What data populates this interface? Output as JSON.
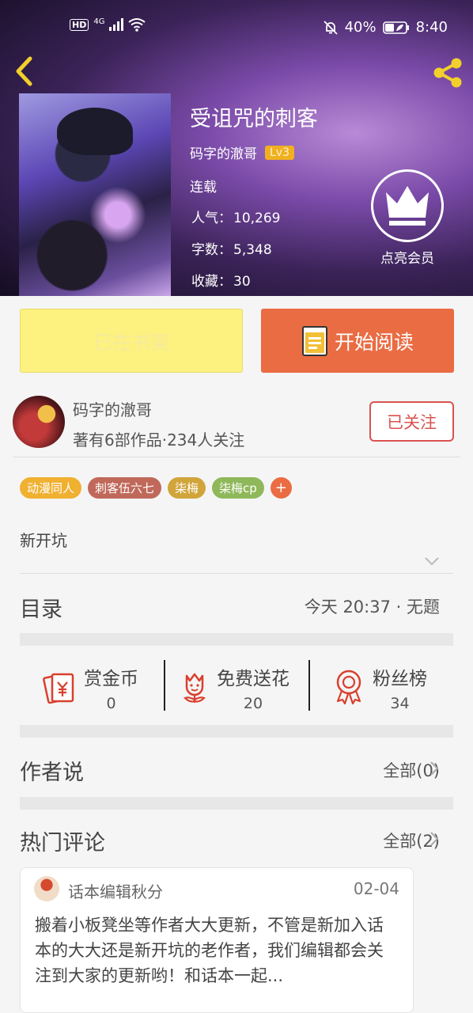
{
  "status_bar": {
    "hd": "HD",
    "network": "4G",
    "battery": "40%",
    "time": "8:40"
  },
  "book": {
    "title": "受诅咒的刺客",
    "author": "码字的澈哥",
    "level": "Lv3",
    "status": "连载",
    "popularity_label": "人气：",
    "popularity": "10,269",
    "words_label": "字数：",
    "words": "5,348",
    "favorites_label": "收藏：",
    "favorites": "30"
  },
  "vip": {
    "label": "点亮会员"
  },
  "actions": {
    "shelf_label": "已在书架",
    "read_label": "开始阅读"
  },
  "author_card": {
    "name": "码字的澈哥",
    "stats": "著有6部作品·234人关注",
    "follow_label": "已关注"
  },
  "tags": [
    {
      "label": "动漫同人",
      "color": "#f0b030"
    },
    {
      "label": "刺客伍六七",
      "color": "#c0695a"
    },
    {
      "label": "柒梅",
      "color": "#d1a53a"
    },
    {
      "label": "柒梅cp",
      "color": "#8fb85a"
    }
  ],
  "tag_add": "+",
  "description": "新开坑",
  "catalog": {
    "title": "目录",
    "latest": "今天 20:37 · 无题"
  },
  "rewards": [
    {
      "label": "赏金币",
      "value": "0",
      "icon": "red-envelope-icon"
    },
    {
      "label": "免费送花",
      "value": "20",
      "icon": "flower-icon"
    },
    {
      "label": "粉丝榜",
      "value": "34",
      "icon": "medal-icon"
    }
  ],
  "author_says": {
    "title": "作者说",
    "all": "全部(0)"
  },
  "hot_comments": {
    "title": "热门评论",
    "all": "全部(2)"
  },
  "comment": {
    "user": "话本编辑秋分",
    "date": "02-04",
    "text": "搬着小板凳坐等作者大大更新，不管是新加入话本的大大还是新开坑的老作者，我们编辑都会关注到大家的更新哟！和话本一起..."
  },
  "colors": {
    "accent": "#ea6c43",
    "shelf": "#fdf17f",
    "follow": "#d9534f",
    "icon_red": "#d9402f",
    "chevron_yellow": "#f2d02c"
  }
}
